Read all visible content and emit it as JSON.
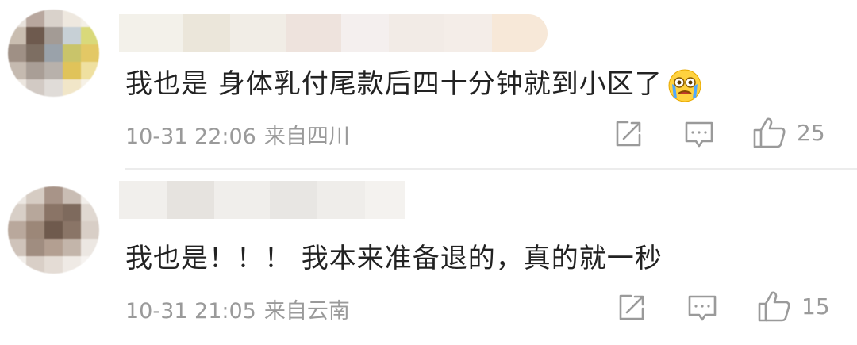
{
  "comments": [
    {
      "text": "我也是 身体乳付尾款后四十分钟就到小区了",
      "emoji": "crying-face-icon",
      "time": "10-31 22:06",
      "location": "来自四川",
      "likes": "25"
    },
    {
      "text": "我也是！！！ 我本来准备退的，真的就一秒",
      "time": "10-31 21:05",
      "location": "来自云南",
      "likes": "15"
    }
  ],
  "colors": {
    "text": "#222222",
    "meta": "#9a9a9a",
    "icon": "#9a9a9a",
    "divider": "#ececec"
  }
}
